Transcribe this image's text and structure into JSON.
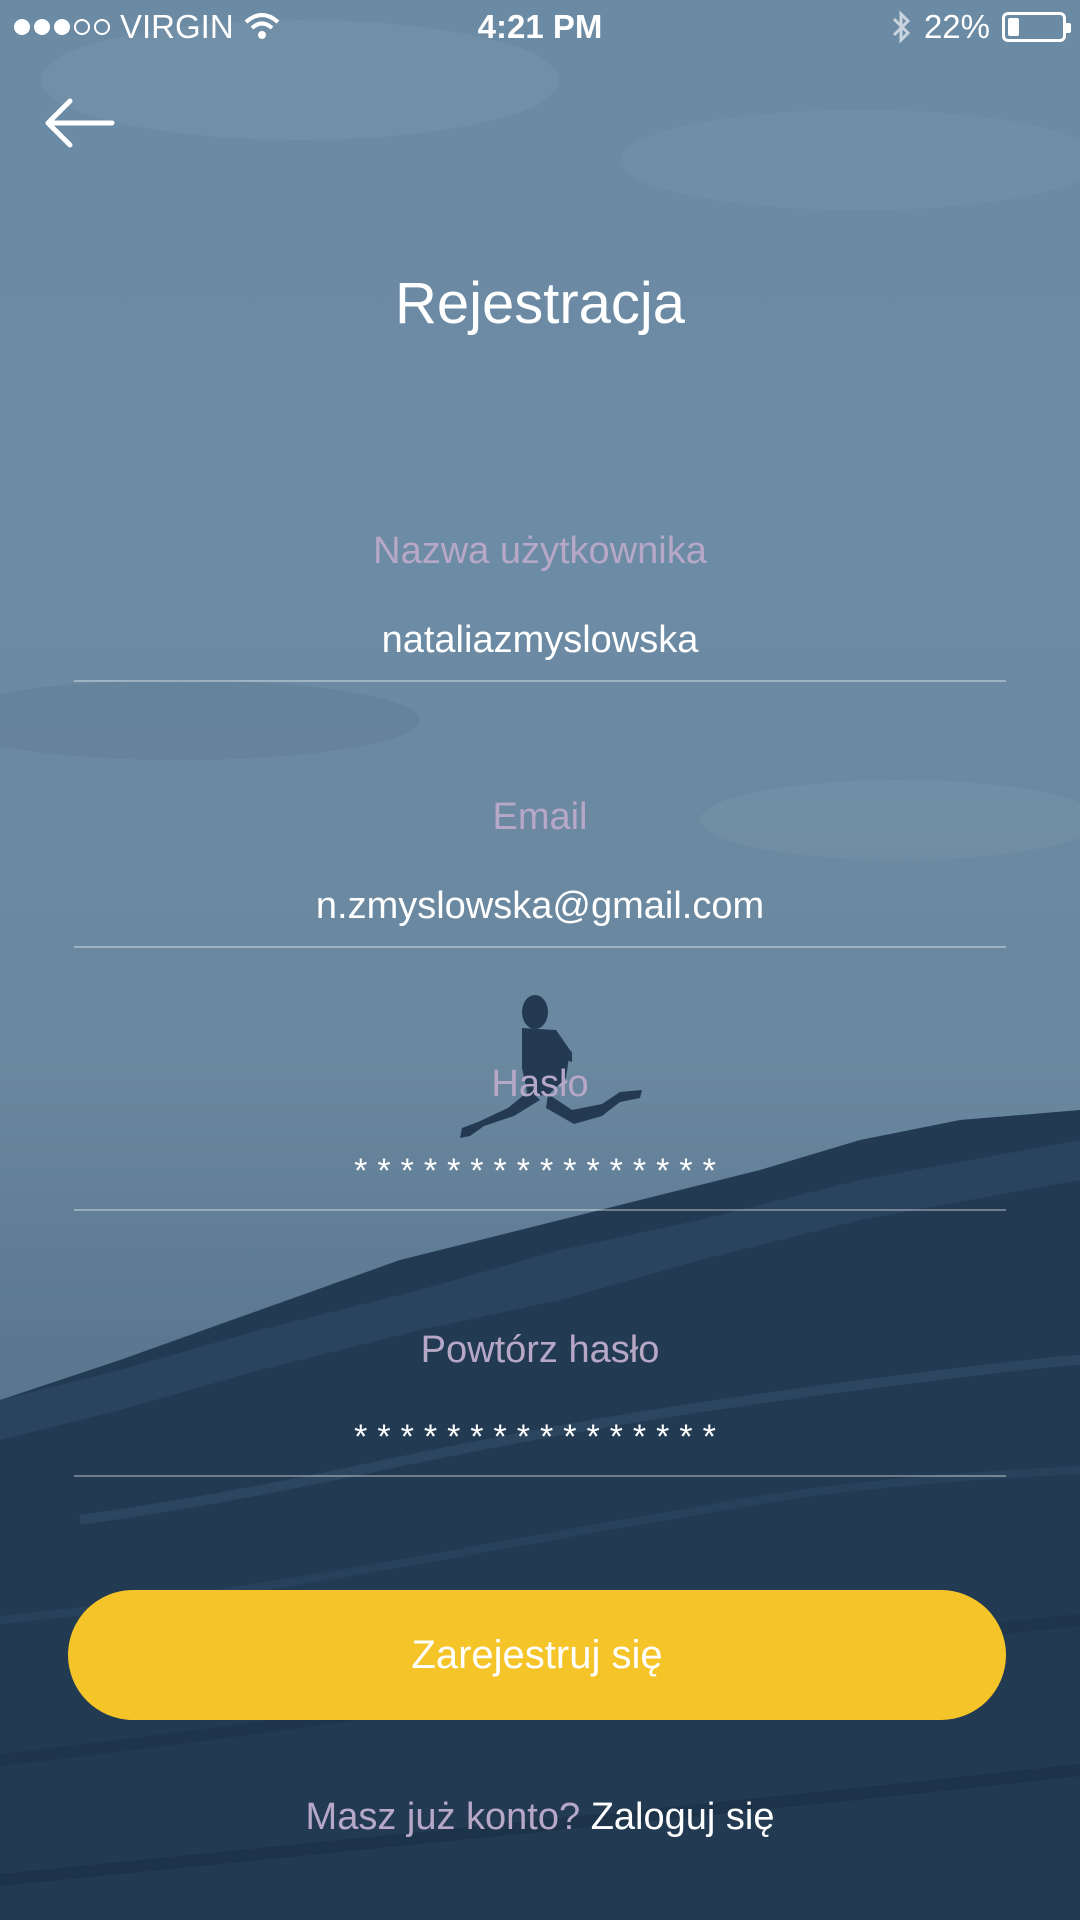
{
  "status_bar": {
    "carrier": "VIRGIN",
    "time": "4:21 PM",
    "battery": "22%",
    "battery_level": 0.22,
    "icons": [
      "signal-dots",
      "wifi-icon",
      "bluetooth-icon",
      "battery-icon"
    ]
  },
  "header": {
    "back_icon": "arrow-left-icon",
    "title": "Rejestracja"
  },
  "form": {
    "username": {
      "label": "Nazwa użytkownika",
      "value": "nataliazmyslowska"
    },
    "email": {
      "label": "Email",
      "value": "n.zmyslowska@gmail.com"
    },
    "password": {
      "label": "Hasło",
      "value": "****************"
    },
    "password_repeat": {
      "label": "Powtórz hasło",
      "value": "****************"
    }
  },
  "submit_label": "Zarejestruj się",
  "footer": {
    "prompt": "Masz już konto?",
    "link": "Zaloguj się"
  },
  "colors": {
    "accent": "#f5c428",
    "label": "#b8a8c8",
    "text": "#ffffff"
  }
}
